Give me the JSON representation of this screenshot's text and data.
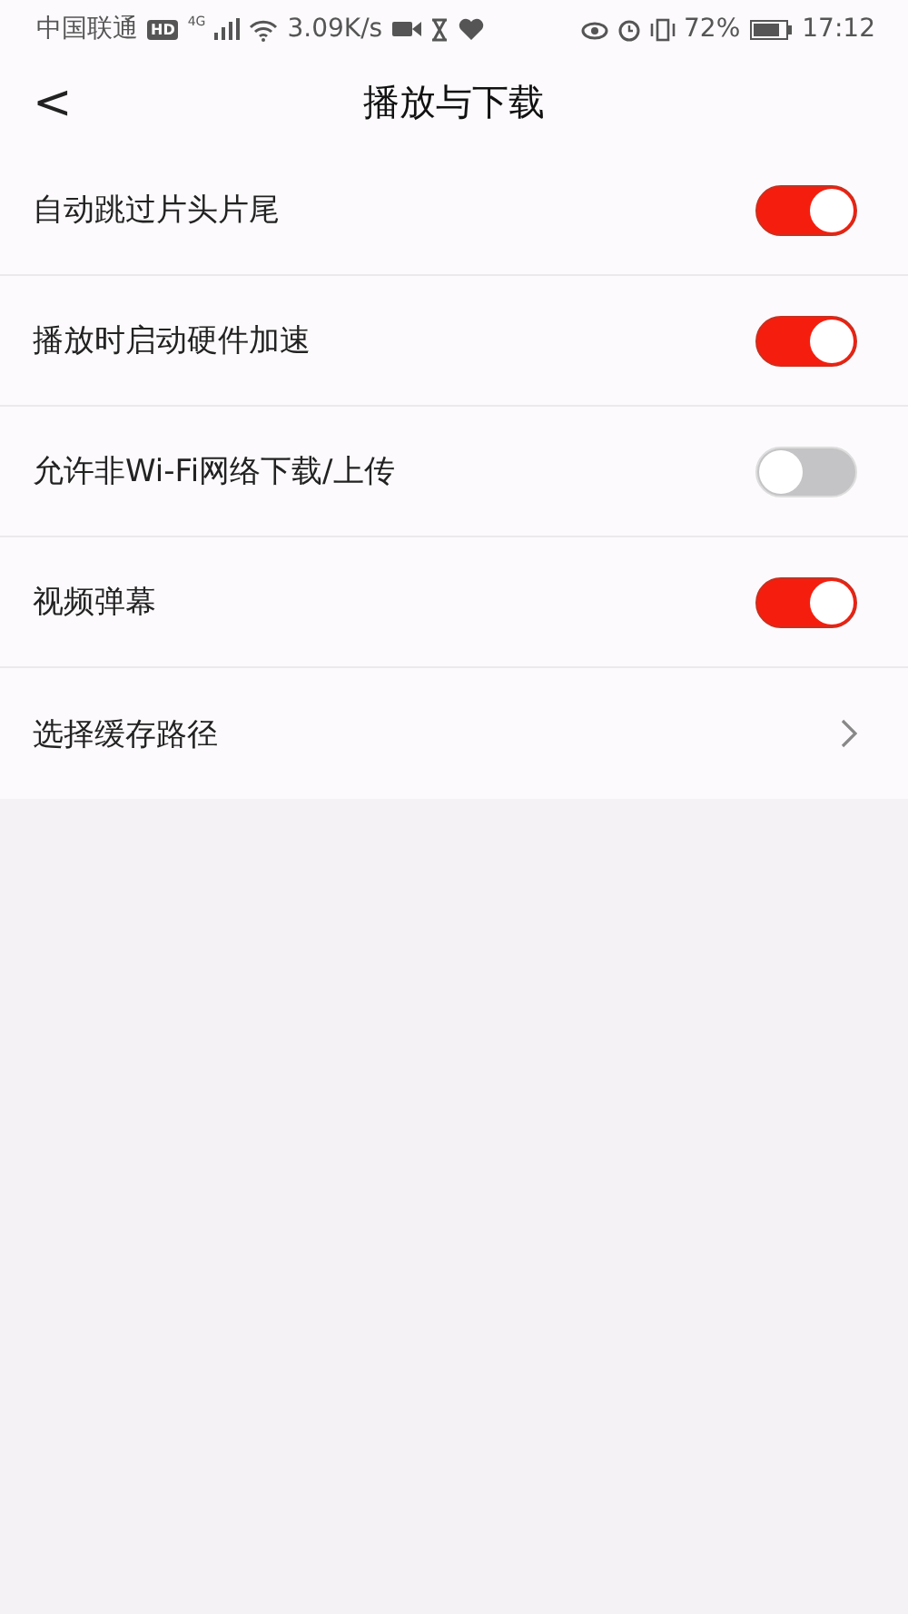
{
  "status_bar": {
    "carrier": "中国联通",
    "hd_badge": "HD",
    "network": "4G",
    "speed": "3.09K/s",
    "battery": "72%",
    "time": "17:12"
  },
  "header": {
    "back": "<",
    "title": "播放与下载"
  },
  "settings": [
    {
      "kind": "toggle",
      "label": "自动跳过片头片尾",
      "on": true
    },
    {
      "kind": "toggle",
      "label": "播放时启动硬件加速",
      "on": true
    },
    {
      "kind": "toggle",
      "label": "允许非Wi-Fi网络下载/上传",
      "on": false
    },
    {
      "kind": "toggle",
      "label": "视频弹幕",
      "on": true
    },
    {
      "kind": "link",
      "label": "选择缓存路径"
    }
  ]
}
